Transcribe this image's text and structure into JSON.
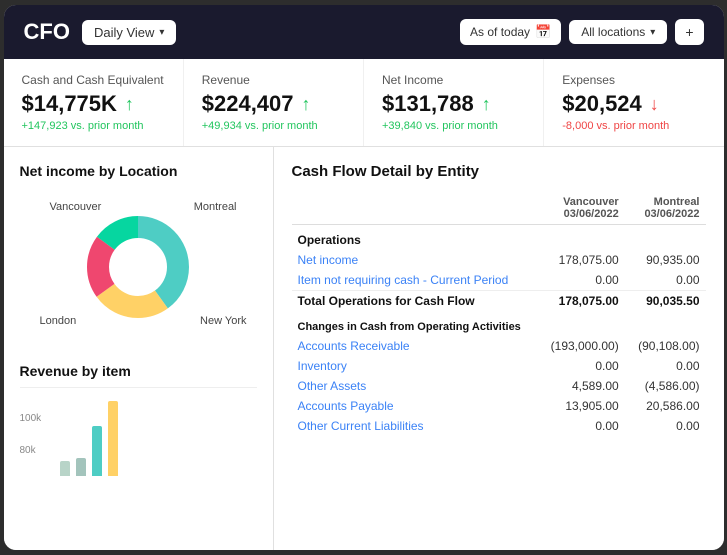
{
  "header": {
    "title": "CFO",
    "daily_view_label": "Daily View",
    "as_of_today_label": "As of today",
    "all_locations_label": "All locations",
    "plus_label": "+"
  },
  "kpis": [
    {
      "label": "Cash and Cash Equivalent",
      "value": "$14,775K",
      "change": "+147,923 vs. prior month",
      "direction": "up"
    },
    {
      "label": "Revenue",
      "value": "$224,407",
      "change": "+49,934 vs. prior month",
      "direction": "up"
    },
    {
      "label": "Net Income",
      "value": "$131,788",
      "change": "+39,840 vs. prior month",
      "direction": "up"
    },
    {
      "label": "Expenses",
      "value": "$20,524",
      "change": "-8,000 vs. prior month",
      "direction": "down"
    }
  ],
  "net_income_chart": {
    "title": "Net income by Location",
    "labels": [
      "Vancouver",
      "Montreal",
      "London",
      "New York"
    ],
    "colors": [
      "#4ecdc4",
      "#ffd166",
      "#ef476f",
      "#06d6a0"
    ],
    "values": [
      40,
      25,
      20,
      15
    ]
  },
  "revenue_chart": {
    "title": "Revenue by item",
    "y_labels": [
      "100k",
      "80k"
    ],
    "bars": [
      {
        "color": "#a3c4bc",
        "height": 15
      },
      {
        "color": "#a3c4bc",
        "height": 18
      },
      {
        "color": "#4ecdc4",
        "height": 50
      },
      {
        "color": "#ffd166",
        "height": 75
      }
    ]
  },
  "cashflow": {
    "title": "Cash Flow Detail by Entity",
    "columns": [
      {
        "name": "Vancouver",
        "date": "03/06/2022"
      },
      {
        "name": "Montreal",
        "date": "03/06/2022"
      }
    ],
    "sections": [
      {
        "type": "section-header",
        "label": "Operations",
        "col1": "",
        "col2": ""
      },
      {
        "type": "link",
        "label": "Net income",
        "col1": "178,075.00",
        "col2": "90,935.00"
      },
      {
        "type": "link",
        "label": "Item not requiring cash - Current Period",
        "col1": "0.00",
        "col2": "0.00"
      },
      {
        "type": "total",
        "label": "Total Operations for Cash Flow",
        "col1": "178,075.00",
        "col2": "90,035.50"
      },
      {
        "type": "changes-header",
        "label": "Changes in Cash from Operating Activities",
        "col1": "",
        "col2": ""
      },
      {
        "type": "link",
        "label": "Accounts Receivable",
        "col1": "(193,000.00)",
        "col2": "(90,108.00)"
      },
      {
        "type": "link",
        "label": "Inventory",
        "col1": "0.00",
        "col2": "0.00"
      },
      {
        "type": "link",
        "label": "Other Assets",
        "col1": "4,589.00",
        "col2": "(4,586.00)"
      },
      {
        "type": "link",
        "label": "Accounts Payable",
        "col1": "13,905.00",
        "col2": "20,586.00"
      },
      {
        "type": "link",
        "label": "Other Current Liabilities",
        "col1": "0.00",
        "col2": "0.00"
      }
    ]
  }
}
